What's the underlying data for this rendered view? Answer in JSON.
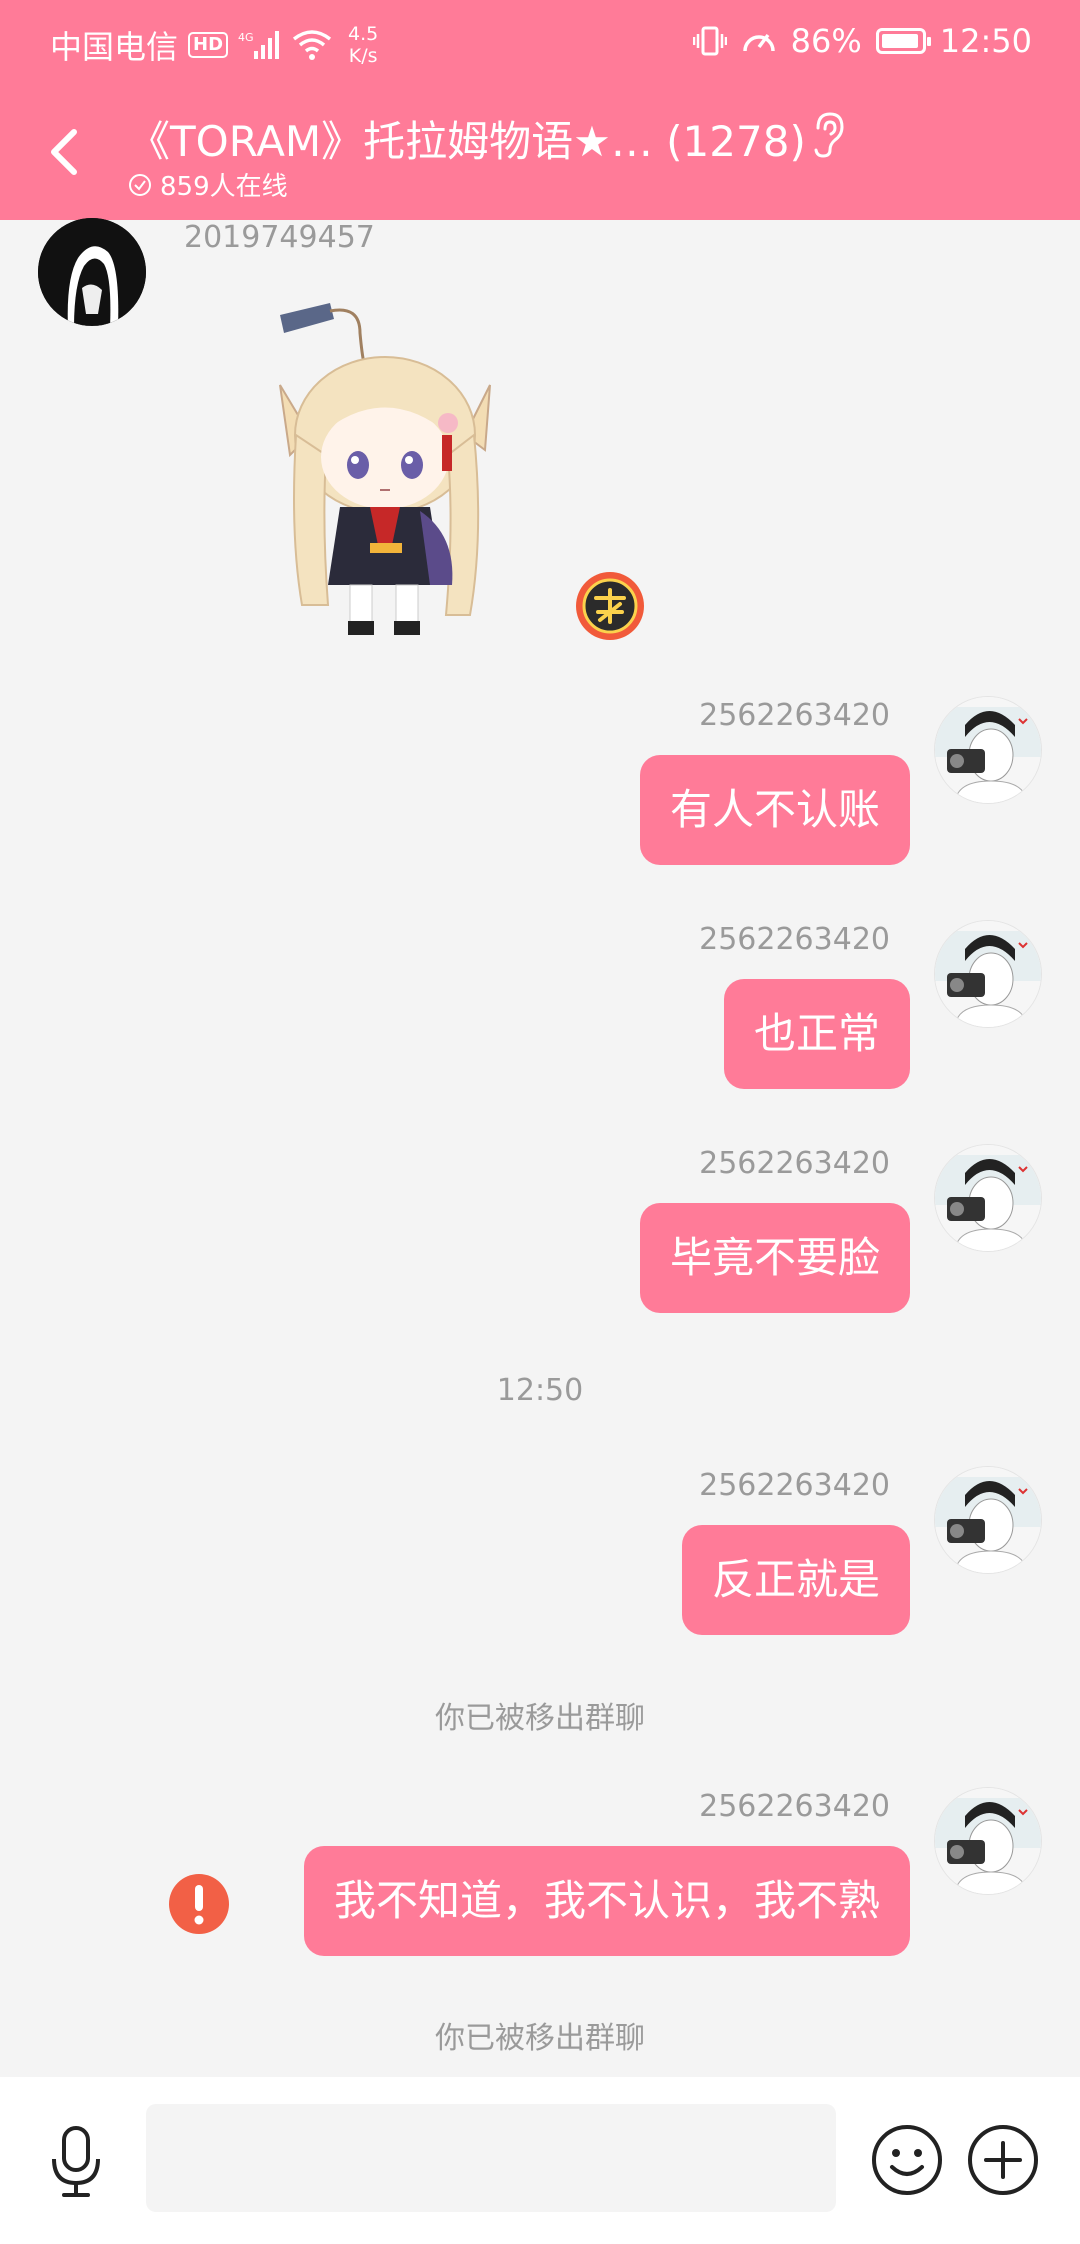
{
  "status_bar": {
    "carrier": "中国电信",
    "hd": "HD",
    "net_speed_value": "4.5",
    "net_speed_unit": "K/s",
    "battery": "86%",
    "time": "12:50"
  },
  "header": {
    "title": "《TORAM》托拉姆物语★… (1278)",
    "online": "859人在线"
  },
  "messages": {
    "m0": {
      "sender": "2019749457"
    },
    "m1": {
      "sender": "2562263420",
      "text": "有人不认账"
    },
    "m2": {
      "sender": "2562263420",
      "text": "也正常"
    },
    "m3": {
      "sender": "2562263420",
      "text": "毕竟不要脸"
    },
    "timestamp": "12:50",
    "m4": {
      "sender": "2562263420",
      "text": "反正就是"
    },
    "system1": "你已被移出群聊",
    "m5": {
      "sender": "2562263420",
      "text": "我不知道，我不认识，我不熟"
    },
    "system2": "你已被移出群聊"
  },
  "input": {
    "placeholder": ""
  },
  "colors": {
    "accent": "#ff7b98",
    "background": "#f4f4f4",
    "warning": "#f26046"
  }
}
